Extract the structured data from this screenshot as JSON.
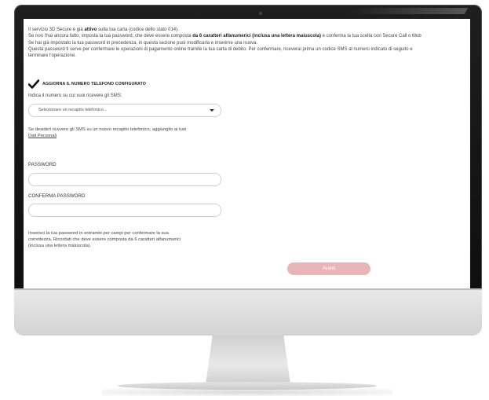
{
  "intro": {
    "line1_before": "Il servizio 3D Secure è già ",
    "line1_bold": "attivo",
    "line1_after": " sulla tua carta (codice dello stato 014).",
    "line2_before": "Se non l'hai ancora fatto, imposta la tua password, che deve essere composta ",
    "line2_bold": "da 6 caratteri alfanumerici (inclusa una lettera maiuscola)",
    "line2_after": " e conferma la tua scelta con Secure Call o Mob",
    "line3": "Se hai già impostato la tua password in precedenza, in questa sezione puoi modificarla e inserirne una nuova.",
    "line4": "Questa password ti serve per confermare le operazioni di pagamento online tramite la tua carta di debito. Per confermare, riceverai prima un codice SMS al numero indicato di seguito e",
    "line5": "terminare l'operazione."
  },
  "checkbox": {
    "label": "AGGIORNA IL NUMERO TELEFONO CONFIGURATO"
  },
  "sms_label": "Indica il numero su cui vuoi ricevere gli SMS:",
  "phone_select": {
    "selected": "Selezionare un recapito telefonico..."
  },
  "note": {
    "line1": "Se desideri ricevere gli SMS su un nuovo recapito telefonico, aggiungilo ai tuoi",
    "link": "Dati Personali"
  },
  "password": {
    "label": "PASSWORD",
    "value": ""
  },
  "confirm_password": {
    "label": "CONFERMA PASSWORD",
    "value": ""
  },
  "hint": {
    "line1": "Inserisci la tua password in entrambi per campi per confermare la sua",
    "line2": "correttezza. Ricordati che deve essere composta da 6 caratteri alfanumerici",
    "line3": "(inclusa una lettera maiuscola)."
  },
  "next_button": {
    "label": "Avanti"
  },
  "colors": {
    "button_bg": "#e8b6b8",
    "bezel": "#111111"
  }
}
